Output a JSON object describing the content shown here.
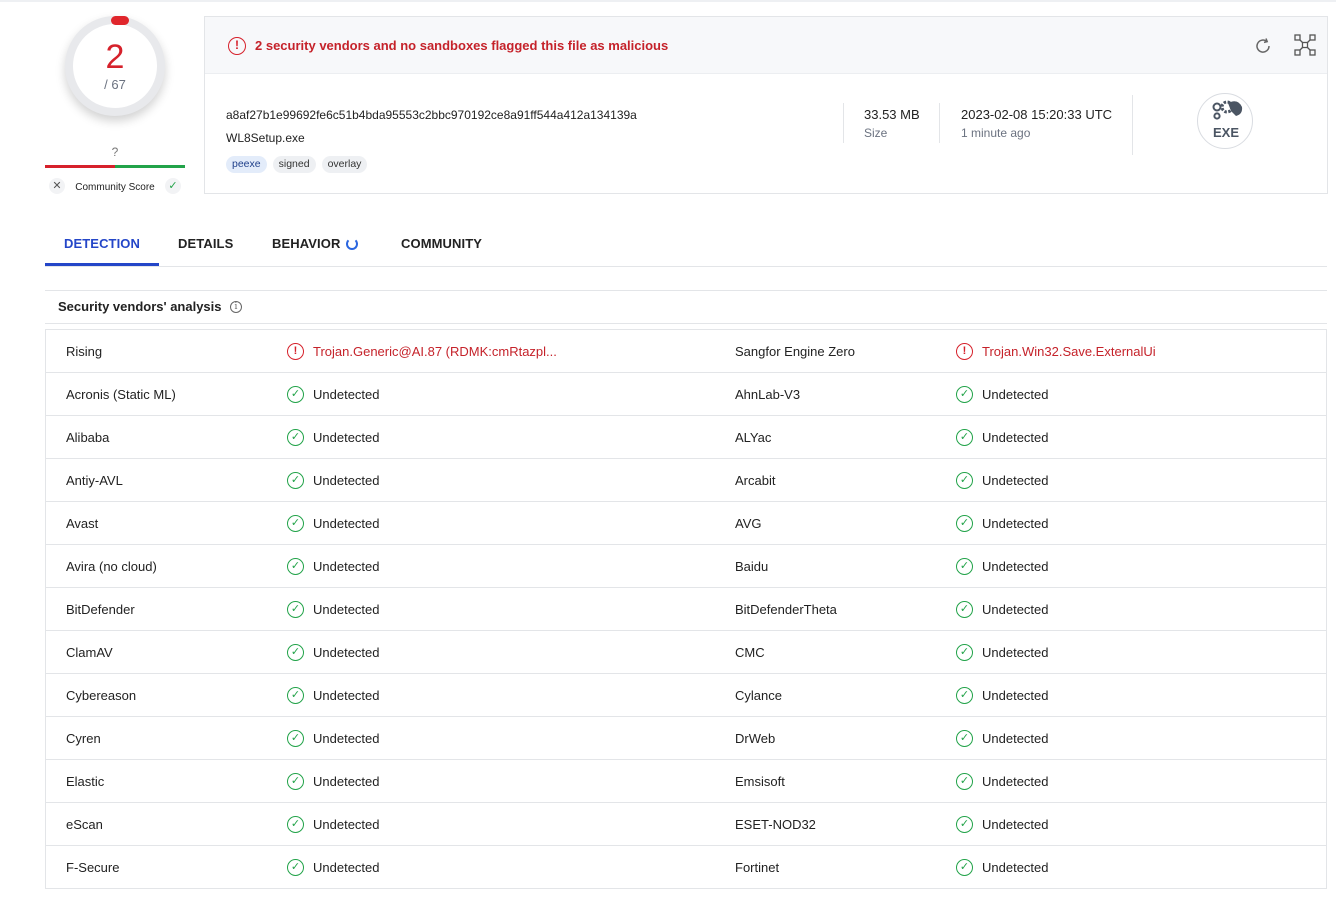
{
  "score": {
    "detections": "2",
    "total": "/ 67"
  },
  "community": {
    "unknown": "?",
    "label": "Community Score",
    "reject_icon": "✕",
    "accept_icon": "✓"
  },
  "alert": {
    "icon": "!",
    "text": "2 security vendors and no sandboxes flagged this file as malicious"
  },
  "file": {
    "hash": "a8af27b1e99692fe6c51b4bda95553c2bbc970192ce8a91ff544a412a134139a",
    "name": "WL8Setup.exe",
    "tags": [
      "peexe",
      "signed",
      "overlay"
    ],
    "size_value": "33.53 MB",
    "size_label": "Size",
    "date_value": "2023-02-08 15:20:33 UTC",
    "date_label": "1 minute ago",
    "type_badge": "EXE"
  },
  "tabs": [
    "DETECTION",
    "DETAILS",
    "BEHAVIOR",
    "COMMUNITY"
  ],
  "section": {
    "title": "Security vendors' analysis",
    "info_icon": "i"
  },
  "vendors": [
    {
      "left": {
        "name": "Rising",
        "result": "Trojan.Generic@AI.87 (RDMK:cmRtazpl...",
        "status": "bad"
      },
      "right": {
        "name": "Sangfor Engine Zero",
        "result": "Trojan.Win32.Save.ExternalUi",
        "status": "bad"
      }
    },
    {
      "left": {
        "name": "Acronis (Static ML)",
        "result": "Undetected",
        "status": "ok"
      },
      "right": {
        "name": "AhnLab-V3",
        "result": "Undetected",
        "status": "ok"
      }
    },
    {
      "left": {
        "name": "Alibaba",
        "result": "Undetected",
        "status": "ok"
      },
      "right": {
        "name": "ALYac",
        "result": "Undetected",
        "status": "ok"
      }
    },
    {
      "left": {
        "name": "Antiy-AVL",
        "result": "Undetected",
        "status": "ok"
      },
      "right": {
        "name": "Arcabit",
        "result": "Undetected",
        "status": "ok"
      }
    },
    {
      "left": {
        "name": "Avast",
        "result": "Undetected",
        "status": "ok"
      },
      "right": {
        "name": "AVG",
        "result": "Undetected",
        "status": "ok"
      }
    },
    {
      "left": {
        "name": "Avira (no cloud)",
        "result": "Undetected",
        "status": "ok"
      },
      "right": {
        "name": "Baidu",
        "result": "Undetected",
        "status": "ok"
      }
    },
    {
      "left": {
        "name": "BitDefender",
        "result": "Undetected",
        "status": "ok"
      },
      "right": {
        "name": "BitDefenderTheta",
        "result": "Undetected",
        "status": "ok"
      }
    },
    {
      "left": {
        "name": "ClamAV",
        "result": "Undetected",
        "status": "ok"
      },
      "right": {
        "name": "CMC",
        "result": "Undetected",
        "status": "ok"
      }
    },
    {
      "left": {
        "name": "Cybereason",
        "result": "Undetected",
        "status": "ok"
      },
      "right": {
        "name": "Cylance",
        "result": "Undetected",
        "status": "ok"
      }
    },
    {
      "left": {
        "name": "Cyren",
        "result": "Undetected",
        "status": "ok"
      },
      "right": {
        "name": "DrWeb",
        "result": "Undetected",
        "status": "ok"
      }
    },
    {
      "left": {
        "name": "Elastic",
        "result": "Undetected",
        "status": "ok"
      },
      "right": {
        "name": "Emsisoft",
        "result": "Undetected",
        "status": "ok"
      }
    },
    {
      "left": {
        "name": "eScan",
        "result": "Undetected",
        "status": "ok"
      },
      "right": {
        "name": "ESET-NOD32",
        "result": "Undetected",
        "status": "ok"
      }
    },
    {
      "left": {
        "name": "F-Secure",
        "result": "Undetected",
        "status": "ok"
      },
      "right": {
        "name": "Fortinet",
        "result": "Undetected",
        "status": "ok"
      }
    }
  ],
  "status_icons": {
    "ok": "✓",
    "bad": "!"
  },
  "colors": {
    "accent": "#2446c8",
    "danger": "#d6212b",
    "success": "#22a349"
  }
}
